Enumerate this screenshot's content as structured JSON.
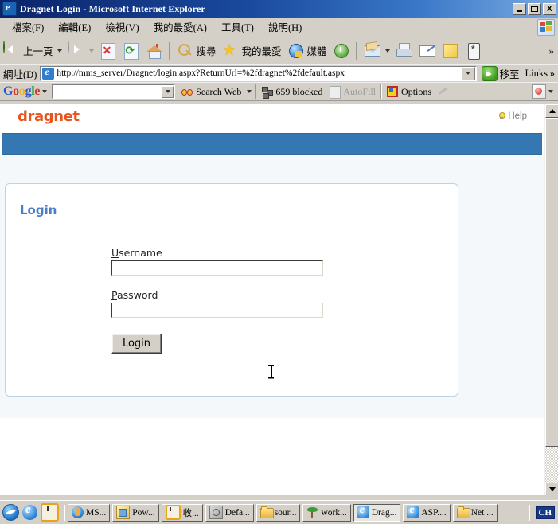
{
  "window": {
    "title": "Dragnet Login - Microsoft Internet Explorer",
    "minimize_label": "_",
    "maximize_label": "",
    "close_label": "X"
  },
  "menubar": {
    "items": [
      {
        "label": "檔案(F)",
        "name": "menu-file"
      },
      {
        "label": "編輯(E)",
        "name": "menu-edit"
      },
      {
        "label": "檢視(V)",
        "name": "menu-view"
      },
      {
        "label": "我的最愛(A)",
        "name": "menu-favorites"
      },
      {
        "label": "工具(T)",
        "name": "menu-tools"
      },
      {
        "label": "說明(H)",
        "name": "menu-help"
      }
    ]
  },
  "toolbar": {
    "back_label": "上一頁",
    "search_label": "搜尋",
    "favorites_label": "我的最愛",
    "media_label": "媒體",
    "overflow_label": "»",
    "icons": {
      "back": "back-arrow-icon",
      "forward": "forward-arrow-icon",
      "stop": "stop-icon",
      "refresh": "refresh-icon",
      "home": "home-icon",
      "search": "search-magnifier-icon",
      "favorites": "star-icon",
      "media": "media-globe-icon",
      "history": "history-icon",
      "mail": "mail-envelope-icon",
      "print": "printer-icon",
      "edit": "edit-page-icon",
      "notes": "note-icon",
      "messenger": "messenger-icon"
    }
  },
  "addressbar": {
    "label": "網址(D)",
    "url": "http://mms_server/Dragnet/login.aspx?ReturnUrl=%2fdragnet%2fdefault.aspx",
    "go_label": "移至",
    "links_label": "Links",
    "links_chevron": "»"
  },
  "googlebar": {
    "logo": {
      "g1": "G",
      "o1": "o",
      "o2": "o",
      "g2": "g",
      "l": "l",
      "e": "e"
    },
    "search_value": "",
    "search_web_label": "Search Web",
    "blocked_label": "659 blocked",
    "autofill_label": "AutoFill",
    "options_label": "Options"
  },
  "page": {
    "logo": "dragnet",
    "help_label": "Help",
    "panel": {
      "title": "Login",
      "username_label_accesskey": "U",
      "username_label_rest": "sername",
      "username_value": "",
      "password_label_accesskey": "P",
      "password_label_rest": "assword",
      "password_value": "",
      "login_button": "Login"
    }
  },
  "taskbar": {
    "tasks": [
      {
        "label": "MS...",
        "icon": "msn-messenger-icon",
        "active": false,
        "name": "taskbar-item-ms"
      },
      {
        "label": "Pow...",
        "icon": "powerpoint-icon",
        "active": false,
        "name": "taskbar-item-pow"
      },
      {
        "label": "收...",
        "icon": "clock-icon",
        "active": false,
        "name": "taskbar-item-inbox"
      },
      {
        "label": "Defa...",
        "icon": "default-app-icon",
        "active": false,
        "name": "taskbar-item-defa"
      },
      {
        "label": "sour...",
        "icon": "folder-icon",
        "active": false,
        "name": "taskbar-item-sour"
      },
      {
        "label": "work...",
        "icon": "palm-tree-icon",
        "active": false,
        "name": "taskbar-item-work"
      },
      {
        "label": "Drag...",
        "icon": "internet-explorer-icon",
        "active": true,
        "name": "taskbar-item-drag"
      },
      {
        "label": "ASP....",
        "icon": "internet-explorer-icon",
        "active": false,
        "name": "taskbar-item-asp"
      },
      {
        "label": "Net ...",
        "icon": "folder-icon",
        "active": false,
        "name": "taskbar-item-net"
      }
    ],
    "tray_label": "CH"
  },
  "colors": {
    "logo_orange": "#e8541e",
    "navbar_blue": "#3577b3",
    "panel_title_blue": "#4a80c8",
    "titlebar_blue": "#0a246a"
  }
}
